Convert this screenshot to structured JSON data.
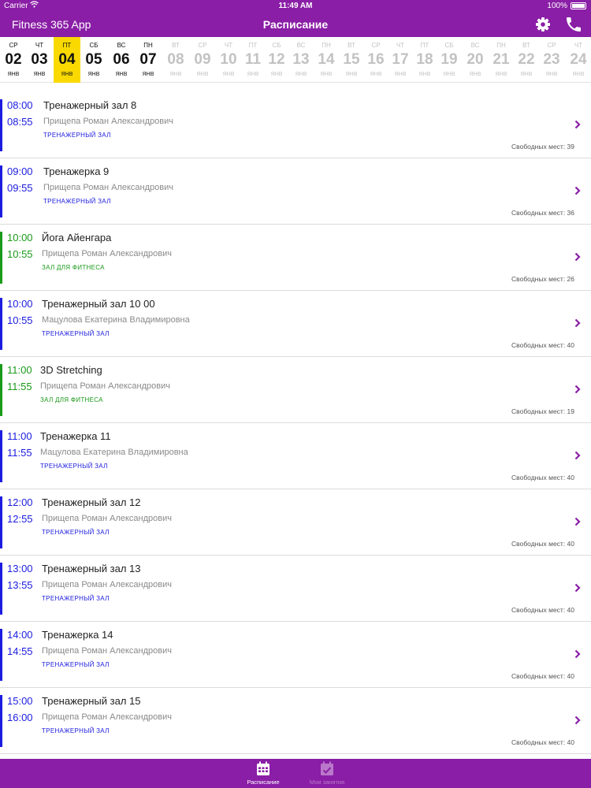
{
  "statusbar": {
    "carrier": "Carrier",
    "time": "11:49 AM",
    "battery": "100%"
  },
  "navbar": {
    "app_name": "Fitness 365 App",
    "title": "Расписание",
    "settings_icon": "gear-icon",
    "call_icon": "phone-icon"
  },
  "colors": {
    "brand": "#8a1ea6",
    "selected_day": "#f9d900",
    "gym": "#1c1ce0",
    "fitness": "#1a9a1a"
  },
  "days": [
    {
      "dow": "СР",
      "num": "02",
      "mon": "ЯНВ",
      "state": "active"
    },
    {
      "dow": "ЧТ",
      "num": "03",
      "mon": "ЯНВ",
      "state": "active"
    },
    {
      "dow": "ПТ",
      "num": "04",
      "mon": "ЯНВ",
      "state": "selected"
    },
    {
      "dow": "СБ",
      "num": "05",
      "mon": "ЯНВ",
      "state": "active"
    },
    {
      "dow": "ВС",
      "num": "06",
      "mon": "ЯНВ",
      "state": "active"
    },
    {
      "dow": "ПН",
      "num": "07",
      "mon": "ЯНВ",
      "state": "active"
    },
    {
      "dow": "ВТ",
      "num": "08",
      "mon": "ЯНВ",
      "state": "inactive"
    },
    {
      "dow": "СР",
      "num": "09",
      "mon": "ЯНВ",
      "state": "inactive"
    },
    {
      "dow": "ЧТ",
      "num": "10",
      "mon": "ЯНВ",
      "state": "inactive"
    },
    {
      "dow": "ПТ",
      "num": "11",
      "mon": "ЯНВ",
      "state": "inactive"
    },
    {
      "dow": "СБ",
      "num": "12",
      "mon": "ЯНВ",
      "state": "inactive"
    },
    {
      "dow": "ВС",
      "num": "13",
      "mon": "ЯНВ",
      "state": "inactive"
    },
    {
      "dow": "ПН",
      "num": "14",
      "mon": "ЯНВ",
      "state": "inactive"
    },
    {
      "dow": "ВТ",
      "num": "15",
      "mon": "ЯНВ",
      "state": "inactive"
    },
    {
      "dow": "СР",
      "num": "16",
      "mon": "ЯНВ",
      "state": "inactive"
    },
    {
      "dow": "ЧТ",
      "num": "17",
      "mon": "ЯНВ",
      "state": "inactive"
    },
    {
      "dow": "ПТ",
      "num": "18",
      "mon": "ЯНВ",
      "state": "inactive"
    },
    {
      "dow": "СБ",
      "num": "19",
      "mon": "ЯНВ",
      "state": "inactive"
    },
    {
      "dow": "ВС",
      "num": "20",
      "mon": "ЯНВ",
      "state": "inactive"
    },
    {
      "dow": "ПН",
      "num": "21",
      "mon": "ЯНВ",
      "state": "inactive"
    },
    {
      "dow": "ВТ",
      "num": "22",
      "mon": "ЯНВ",
      "state": "inactive"
    },
    {
      "dow": "СР",
      "num": "23",
      "mon": "ЯНВ",
      "state": "inactive"
    },
    {
      "dow": "ЧТ",
      "num": "24",
      "mon": "ЯНВ",
      "state": "inactive"
    }
  ],
  "classes": [
    {
      "start": "08:00",
      "end": "08:55",
      "name": "Тренажерный зал 8",
      "trainer": "Прищепа Роман Александрович",
      "location": "ТРЕНАЖЕРНЫЙ ЗАЛ",
      "kind": "gym",
      "places": "Свободных мест: 39"
    },
    {
      "start": "09:00",
      "end": "09:55",
      "name": "Тренажерка 9",
      "trainer": "Прищепа Роман Александрович",
      "location": "ТРЕНАЖЕРНЫЙ ЗАЛ",
      "kind": "gym",
      "places": "Свободных мест: 36"
    },
    {
      "start": "10:00",
      "end": "10:55",
      "name": "Йога Айенгара",
      "trainer": "Прищепа Роман Александрович",
      "location": "ЗАЛ ДЛЯ ФИТНЕСА",
      "kind": "fitness",
      "places": "Свободных мест: 26"
    },
    {
      "start": "10:00",
      "end": "10:55",
      "name": "Тренажерный зал 10 00",
      "trainer": "Мацулова Екатерина Владимировна",
      "location": "ТРЕНАЖЕРНЫЙ ЗАЛ",
      "kind": "gym",
      "places": "Свободных мест: 40"
    },
    {
      "start": "11:00",
      "end": "11:55",
      "name": "3D Stretching",
      "trainer": "Прищепа Роман Александрович",
      "location": "ЗАЛ ДЛЯ ФИТНЕСА",
      "kind": "fitness",
      "places": "Свободных мест: 19"
    },
    {
      "start": "11:00",
      "end": "11:55",
      "name": "Тренажерка 11",
      "trainer": "Мацулова Екатерина Владимировна",
      "location": "ТРЕНАЖЕРНЫЙ ЗАЛ",
      "kind": "gym",
      "places": "Свободных мест: 40"
    },
    {
      "start": "12:00",
      "end": "12:55",
      "name": "Тренажерный зал 12",
      "trainer": "Прищепа Роман Александрович",
      "location": "ТРЕНАЖЕРНЫЙ ЗАЛ",
      "kind": "gym",
      "places": "Свободных мест: 40"
    },
    {
      "start": "13:00",
      "end": "13:55",
      "name": "Тренажерный зал 13",
      "trainer": "Прищепа Роман Александрович",
      "location": "ТРЕНАЖЕРНЫЙ ЗАЛ",
      "kind": "gym",
      "places": "Свободных мест: 40"
    },
    {
      "start": "14:00",
      "end": "14:55",
      "name": "Тренажерка 14",
      "trainer": "Прищепа Роман Александрович",
      "location": "ТРЕНАЖЕРНЫЙ ЗАЛ",
      "kind": "gym",
      "places": "Свободных мест: 40"
    },
    {
      "start": "15:00",
      "end": "16:00",
      "name": "Тренажерный зал 15",
      "trainer": "Прищепа Роман Александрович",
      "location": "ТРЕНАЖЕРНЫЙ ЗАЛ",
      "kind": "gym",
      "places": "Свободных мест: 40"
    }
  ],
  "tabbar": {
    "tabs": [
      {
        "label": "Расписание",
        "icon": "calendar-icon",
        "active": true
      },
      {
        "label": "Мои занятия",
        "icon": "calendar-check-icon",
        "active": false
      }
    ]
  }
}
